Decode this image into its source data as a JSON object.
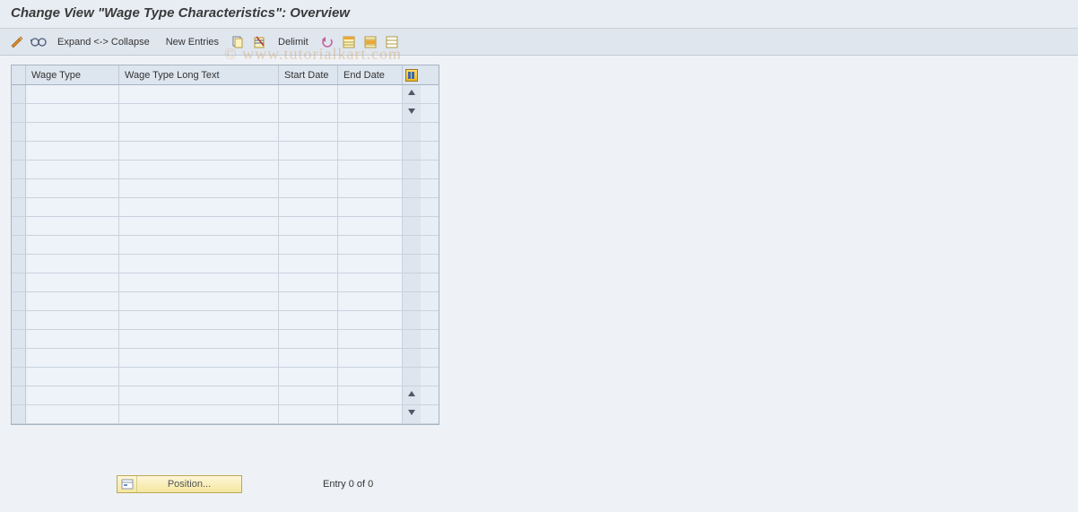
{
  "title": "Change View \"Wage Type Characteristics\": Overview",
  "toolbar": {
    "expand_collapse": "Expand <-> Collapse",
    "new_entries": "New Entries",
    "delimit": "Delimit",
    "icons": {
      "pencil_toggle": "toggle-display-change-icon",
      "glasses": "other-view-icon",
      "copy": "copy-icon",
      "delete": "delete-icon",
      "undo": "undo-icon",
      "select_all": "select-all-icon",
      "select_block": "select-block-icon",
      "deselect_all": "deselect-all-icon"
    }
  },
  "table": {
    "columns": [
      "Wage Type",
      "Wage Type Long Text",
      "Start Date",
      "End Date"
    ],
    "row_count": 18,
    "rows": [
      [
        "",
        "",
        "",
        ""
      ],
      [
        "",
        "",
        "",
        ""
      ],
      [
        "",
        "",
        "",
        ""
      ],
      [
        "",
        "",
        "",
        ""
      ],
      [
        "",
        "",
        "",
        ""
      ],
      [
        "",
        "",
        "",
        ""
      ],
      [
        "",
        "",
        "",
        ""
      ],
      [
        "",
        "",
        "",
        ""
      ],
      [
        "",
        "",
        "",
        ""
      ],
      [
        "",
        "",
        "",
        ""
      ],
      [
        "",
        "",
        "",
        ""
      ],
      [
        "",
        "",
        "",
        ""
      ],
      [
        "",
        "",
        "",
        ""
      ],
      [
        "",
        "",
        "",
        ""
      ],
      [
        "",
        "",
        "",
        ""
      ],
      [
        "",
        "",
        "",
        ""
      ],
      [
        "",
        "",
        "",
        ""
      ],
      [
        "",
        "",
        "",
        ""
      ]
    ]
  },
  "footer": {
    "position_label": "Position...",
    "entry_text": "Entry 0 of 0"
  },
  "watermark": "© www.tutorialkart.com"
}
